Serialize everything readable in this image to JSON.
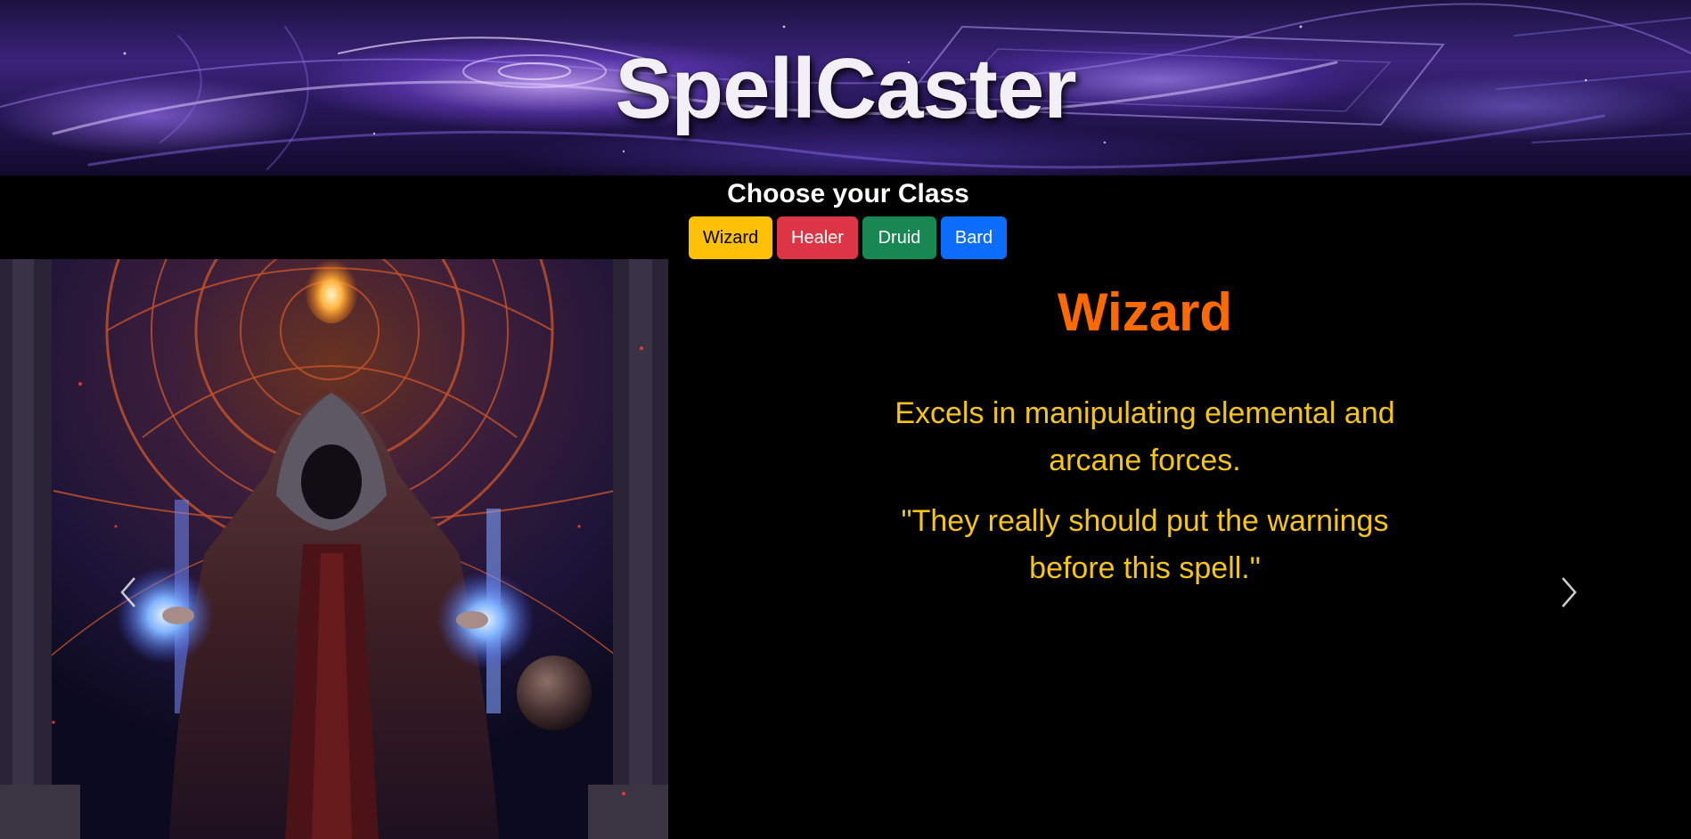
{
  "header": {
    "title": "SpellCaster"
  },
  "chooser": {
    "heading": "Choose your Class",
    "buttons": [
      {
        "label": "Wizard",
        "color": "#ffc107"
      },
      {
        "label": "Healer",
        "color": "#dc3545"
      },
      {
        "label": "Druid",
        "color": "#198754"
      },
      {
        "label": "Bard",
        "color": "#0d6efd"
      }
    ]
  },
  "carousel": {
    "active_slide": {
      "class_name": "Wizard",
      "description": "Excels in manipulating elemental and arcane forces.",
      "quote": "\"They really should put the warnings before this spell.\"",
      "title_color": "#ff6a00",
      "text_color": "#f5c518"
    },
    "controls": {
      "prev_icon": "chevron-left-icon",
      "next_icon": "chevron-right-icon"
    }
  }
}
